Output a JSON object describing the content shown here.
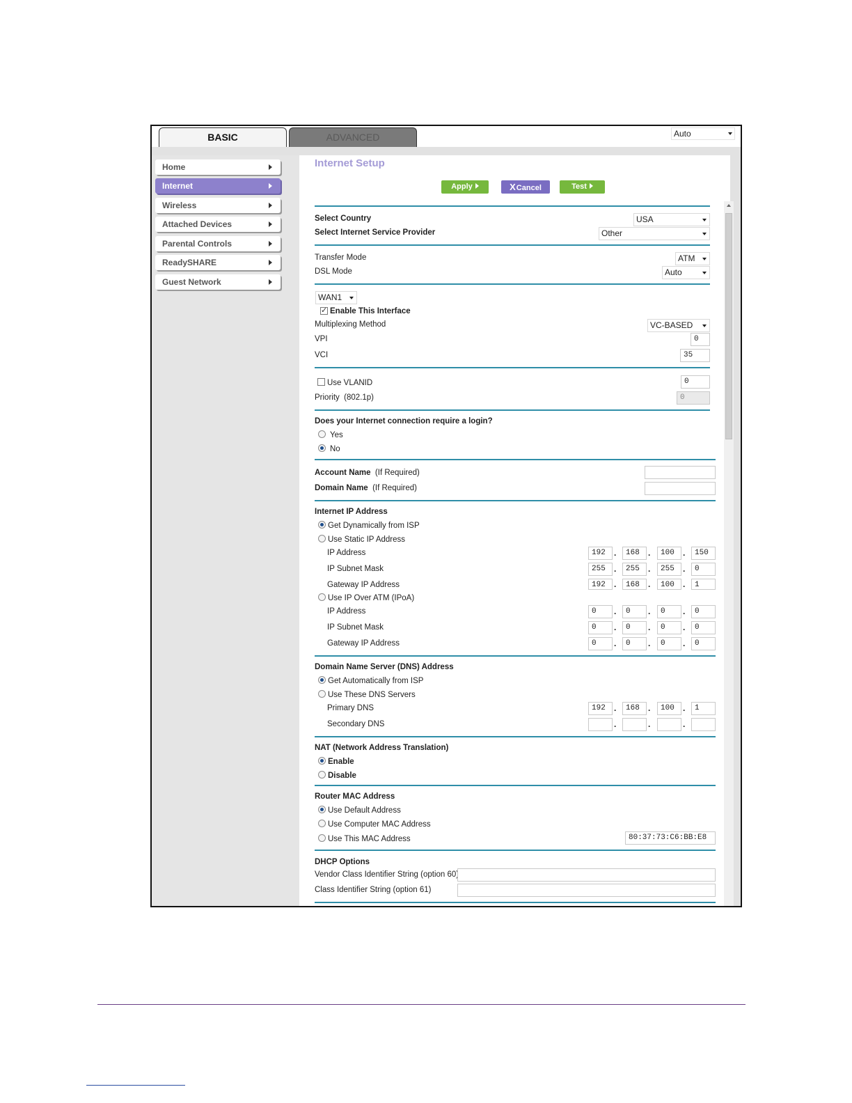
{
  "tabs": {
    "basic": "BASIC",
    "advanced": "ADVANCED"
  },
  "language_select": "Auto",
  "sidebar": {
    "items": [
      {
        "label": "Home"
      },
      {
        "label": "Internet"
      },
      {
        "label": "Wireless"
      },
      {
        "label": "Attached Devices"
      },
      {
        "label": "Parental Controls"
      },
      {
        "label": "ReadySHARE"
      },
      {
        "label": "Guest Network"
      }
    ],
    "active": "Internet"
  },
  "page": {
    "title": "Internet Setup"
  },
  "buttons": {
    "apply": "Apply",
    "cancel": "Cancel",
    "test": "Test",
    "cancel_x": "X"
  },
  "country": {
    "label": "Select Country",
    "value": "USA"
  },
  "isp": {
    "label": "Select Internet Service Provider",
    "value": "Other"
  },
  "transfer_mode": {
    "label": "Transfer Mode",
    "value": "ATM"
  },
  "dsl_mode": {
    "label": "DSL Mode",
    "value": "Auto"
  },
  "wan": {
    "select": "WAN1",
    "enable_label": "Enable This Interface",
    "enable_checked": true,
    "multiplexing_label": "Multiplexing Method",
    "multiplexing_value": "VC-BASED",
    "vpi_label": "VPI",
    "vpi_value": "0",
    "vci_label": "VCI",
    "vci_value": "35"
  },
  "vlan": {
    "use_label": "Use VLANID",
    "checked": false,
    "value": "0",
    "priority_label": "Priority",
    "priority_note": "(802.1p)",
    "priority_value": "0"
  },
  "login": {
    "question": "Does your Internet connection require a login?",
    "yes": "Yes",
    "no": "No",
    "selected": "No"
  },
  "account": {
    "account_label": "Account Name",
    "account_note": "(If Required)",
    "domain_label": "Domain Name",
    "domain_note": "(If Required)",
    "account_value": "",
    "domain_value": ""
  },
  "internet_ip": {
    "heading": "Internet IP Address",
    "dynamic_label": "Get Dynamically from ISP",
    "static_label": "Use Static IP Address",
    "ipoa_label": "Use IP Over ATM (IPoA)",
    "selected": "Get Dynamically from ISP",
    "ip_label": "IP Address",
    "mask_label": "IP Subnet Mask",
    "gateway_label": "Gateway IP Address",
    "static_ip": [
      "192",
      "168",
      "100",
      "150"
    ],
    "static_mask": [
      "255",
      "255",
      "255",
      "0"
    ],
    "static_gateway": [
      "192",
      "168",
      "100",
      "1"
    ],
    "ipoa_ip": [
      "0",
      "0",
      "0",
      "0"
    ],
    "ipoa_mask": [
      "0",
      "0",
      "0",
      "0"
    ],
    "ipoa_gateway": [
      "0",
      "0",
      "0",
      "0"
    ]
  },
  "dns": {
    "heading": "Domain Name Server (DNS) Address",
    "auto_label": "Get Automatically from ISP",
    "manual_label": "Use These DNS Servers",
    "selected": "Get Automatically from ISP",
    "primary_label": "Primary DNS",
    "secondary_label": "Secondary DNS",
    "primary": [
      "192",
      "168",
      "100",
      "1"
    ],
    "secondary": [
      "",
      "",
      "",
      ""
    ]
  },
  "nat": {
    "heading": "NAT (Network Address Translation)",
    "enable": "Enable",
    "disable": "Disable",
    "selected": "Enable"
  },
  "mac": {
    "heading": "Router MAC Address",
    "default_label": "Use Default Address",
    "computer_label": "Use Computer MAC Address",
    "this_label": "Use This MAC Address",
    "selected": "Use Default Address",
    "value": "80:37:73:C6:BB:E8"
  },
  "dhcp": {
    "heading": "DHCP Options",
    "vendor_label": "Vendor Class Identifier String (option 60)",
    "class_label": "Class Identifier String (option 61)",
    "vendor_value": "",
    "class_value": ""
  },
  "colors": {
    "accent_purple": "#8d81cc",
    "title_purple": "#a49bd6",
    "button_green": "#76b83d",
    "divider_teal": "#2f8ea8"
  }
}
